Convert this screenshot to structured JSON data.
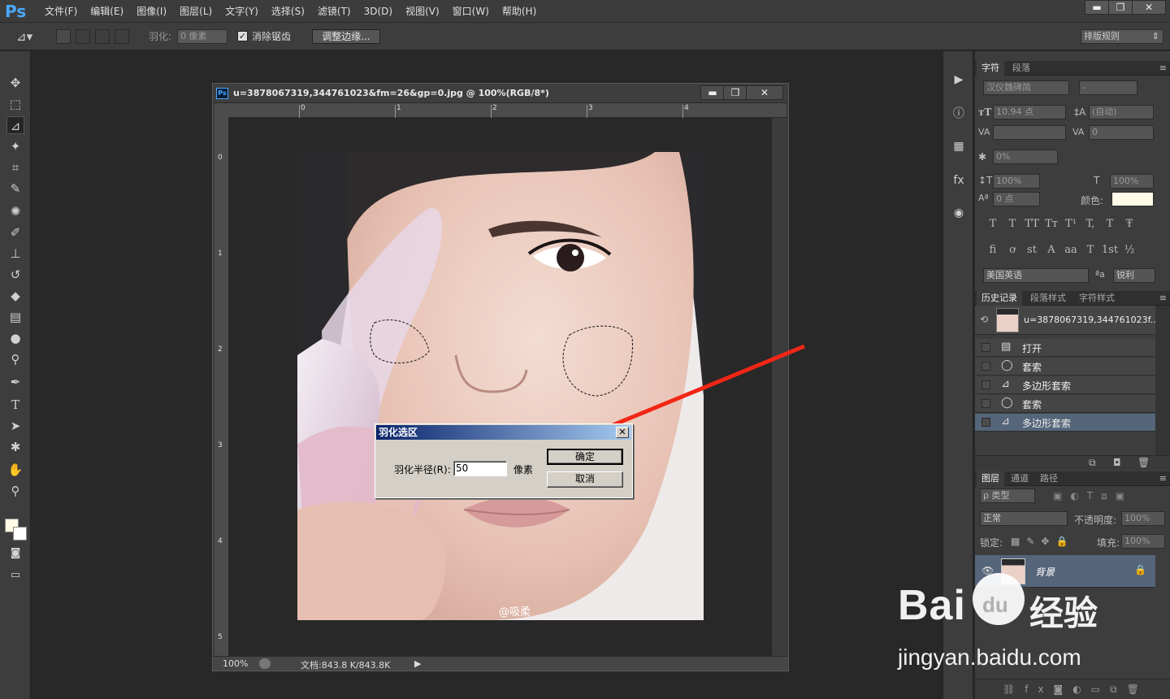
{
  "app": {
    "logo": "Ps",
    "menus": [
      "文件(F)",
      "编辑(E)",
      "图像(I)",
      "图层(L)",
      "文字(Y)",
      "选择(S)",
      "滤镜(T)",
      "3D(D)",
      "视图(V)",
      "窗口(W)",
      "帮助(H)"
    ],
    "win_minimize": "▬",
    "win_restore": "❐",
    "win_close": "✕"
  },
  "options": {
    "feather_label": "羽化:",
    "feather_value": "0 像素",
    "antialias_label": "消除锯齿",
    "refine_edge_label": "调整边缘...",
    "workspace": "排版规则"
  },
  "document": {
    "title": "u=3878067319,344761023&fm=26&gp=0.jpg @ 100%(RGB/8*)",
    "ps_icon": "Ps",
    "h_ruler": [
      "0",
      "1",
      "2",
      "3",
      "4"
    ],
    "v_ruler": [
      "0",
      "1",
      "2",
      "3",
      "4",
      "5"
    ],
    "zoom": "100%",
    "doc_size": "文档:843.8 K/843.8K",
    "watermark_text": "@吸柔",
    "btn_min": "▬",
    "btn_max": "❐",
    "btn_close": "✕"
  },
  "dialog": {
    "title": "羽化选区",
    "close": "✕",
    "radius_label": "羽化半径(R):",
    "radius_value": "50",
    "unit": "像素",
    "ok": "确定",
    "cancel": "取消"
  },
  "character": {
    "tabs": [
      "字符",
      "段落"
    ],
    "font_family": "汉仪魏碑简",
    "font_style": "-",
    "font_size": "10.94 点",
    "leading": "(自动)",
    "kerning": "",
    "tracking": "0",
    "vscale_pct": "0%",
    "v_scale": "100%",
    "h_scale": "100%",
    "baseline": "0 点",
    "color_label": "颜色:",
    "glyphs_row1": [
      "T",
      "T",
      "TT",
      "Tт",
      "T¹",
      "T,",
      "T",
      "Ŧ"
    ],
    "glyphs_row2": [
      "fi",
      "ơ",
      "st",
      "A",
      "aa",
      "T",
      "1st",
      "½"
    ],
    "language": "美国英语",
    "aa_icon": "ªa",
    "aa_mode": "锐利"
  },
  "history": {
    "tabs": [
      "历史记录",
      "段落样式",
      "字符样式"
    ],
    "snapshot": "u=3878067319,344761023f...",
    "items": [
      {
        "icon": "▤",
        "label": "打开"
      },
      {
        "icon": "◯",
        "label": "套索"
      },
      {
        "icon": "⊿",
        "label": "多边形套索"
      },
      {
        "icon": "◯",
        "label": "套索"
      },
      {
        "icon": "⊿",
        "label": "多边形套索"
      }
    ]
  },
  "layers": {
    "tabs": [
      "图层",
      "通道",
      "路径"
    ],
    "filter": "ρ 类型",
    "blend_mode": "正常",
    "opacity_label": "不透明度:",
    "opacity": "100%",
    "lock_label": "锁定:",
    "fill_label": "填充:",
    "fill": "100%",
    "layer_name": "背景"
  },
  "baidu": {
    "brand": "Bai",
    "du": "du",
    "jingyan": "经验",
    "url": "jingyan.baidu.com"
  }
}
